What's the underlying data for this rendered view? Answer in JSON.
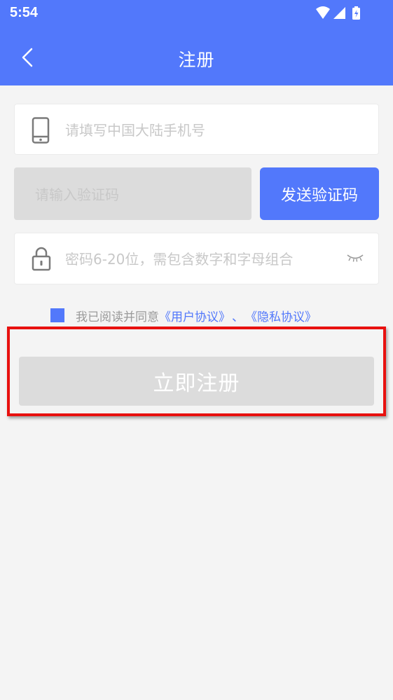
{
  "status_bar": {
    "time": "5:54",
    "icons": [
      "wifi-icon",
      "cellular-signal-icon",
      "battery-charging-icon"
    ]
  },
  "app_bar": {
    "title": "注册",
    "back_icon": "chevron-left-icon"
  },
  "form": {
    "phone": {
      "placeholder": "请填写中国大陆手机号",
      "value": "",
      "icon": "phone-icon"
    },
    "code": {
      "placeholder": "请输入验证码",
      "value": ""
    },
    "send_code_label": "发送验证码",
    "password": {
      "placeholder": "密码6-20位，需包含数字和字母组合",
      "value": "",
      "icon": "lock-icon",
      "toggle_icon": "eye-closed-icon"
    }
  },
  "agreement": {
    "checked": true,
    "text": "我已阅读并同意",
    "user_agreement": "《用户协议》",
    "separator": "、",
    "privacy_policy": "《隐私协议》"
  },
  "register_button_label": "立即注册",
  "colors": {
    "primary": "#5278fb",
    "background": "#f4f4f4",
    "disabled": "#dcdcdc",
    "highlight": "#e8110f"
  }
}
